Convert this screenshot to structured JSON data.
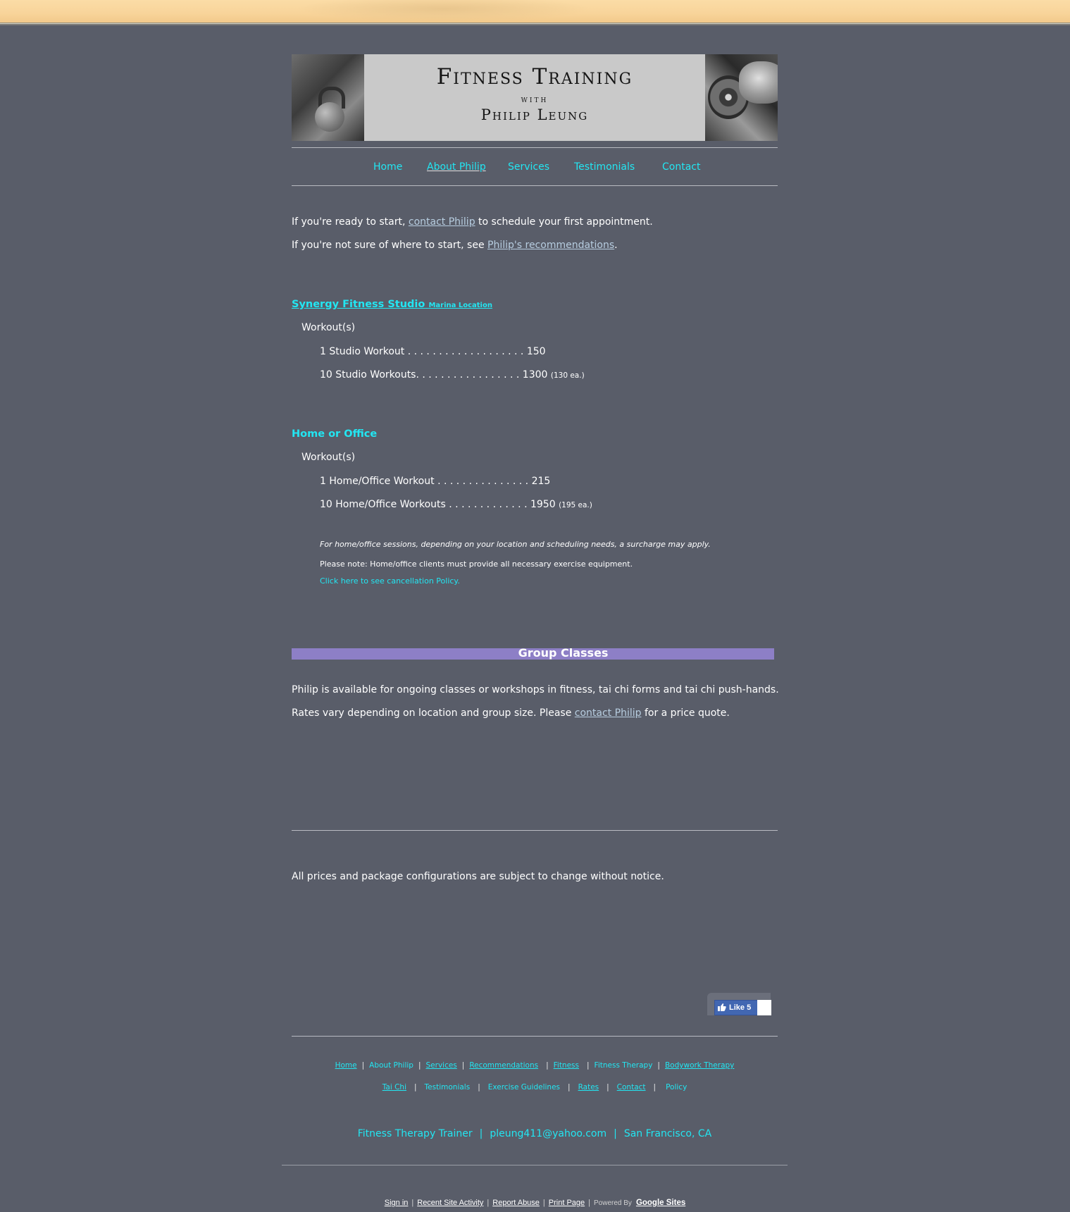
{
  "banner": {
    "title_line1": "Fitness Training",
    "title_line2": "with",
    "title_line3": "Philip Leung"
  },
  "nav": {
    "items": [
      {
        "label": "Home"
      },
      {
        "label": "About Philip",
        "current": true
      },
      {
        "label": "Services"
      },
      {
        "label": "Testimonials"
      },
      {
        "label": "Contact"
      }
    ]
  },
  "intro": {
    "line1_prefix": "If you're ready to start, ",
    "line1_link": "contact Philip",
    "line1_suffix": " to schedule your first appointment.",
    "line2_prefix": "If you're not sure of where to start, see ",
    "line2_link": "Philip's recommendations",
    "line2_suffix": "."
  },
  "studio": {
    "heading": "Synergy Fitness Studio",
    "heading_small": "Marina Location",
    "subheading": "Workout(s)",
    "items": [
      {
        "text": "1  Studio Workout . . . . . . . . . . . . . . . . . . .  150",
        "note": ""
      },
      {
        "text": "10  Studio Workouts. . . . . . . . . . . . . . . . .  1300",
        "note": "(130 ea.)"
      }
    ]
  },
  "home_office": {
    "heading": "Home or Office",
    "subheading": "Workout(s)",
    "items": [
      {
        "text": "1  Home/Office Workout . . . . . . . . . . . . . . .  215",
        "note": ""
      },
      {
        "text": "10  Home/Office Workouts . . . . . . . . . . . . . 1950",
        "note": "(195 ea.)"
      }
    ],
    "note_surcharge": "For home/office sessions, depending on your location and scheduling needs, a surcharge may apply.",
    "note_equipment": "Please note: Home/office clients must provide all necessary exercise equipment.",
    "cancellation_link": "Click here to see cancellation Policy."
  },
  "group": {
    "heading": "Group Classes",
    "line1": "Philip is available for ongoing classes or workshops in fitness, tai chi forms and tai chi push-hands.",
    "line2_prefix": "Rates vary depending on location and group size.  Please ",
    "line2_link": "contact Philip",
    "line2_suffix": " for a price quote."
  },
  "disclaimer": "All prices and package configurations are subject to change without notice.",
  "like": {
    "label": "Like 5"
  },
  "footer": {
    "row1": [
      "Home",
      "About Philip",
      "Services",
      "Recommendations",
      "Fitness",
      "Fitness Therapy",
      "Bodywork Therapy"
    ],
    "row2": [
      "Tai Chi",
      "Testimonials",
      "Exercise Guidelines",
      "Rates",
      "Contact",
      "Policy"
    ],
    "sep": "|",
    "contact_title": "Fitness Therapy Trainer",
    "contact_email": "pleung411@yahoo.com",
    "contact_location": "San Francisco, CA"
  },
  "site_footer": {
    "sign_in": "Sign in",
    "recent_activity": "Recent Site Activity",
    "report_abuse": "Report Abuse",
    "print_page": "Print Page",
    "powered_by": "Powered By",
    "google_sites": "Google Sites"
  },
  "colors": {
    "background": "#595d69",
    "link_cyan": "#22e6f2",
    "group_bar": "#8d7fc6",
    "banner_bg": "#c9c9c9"
  }
}
